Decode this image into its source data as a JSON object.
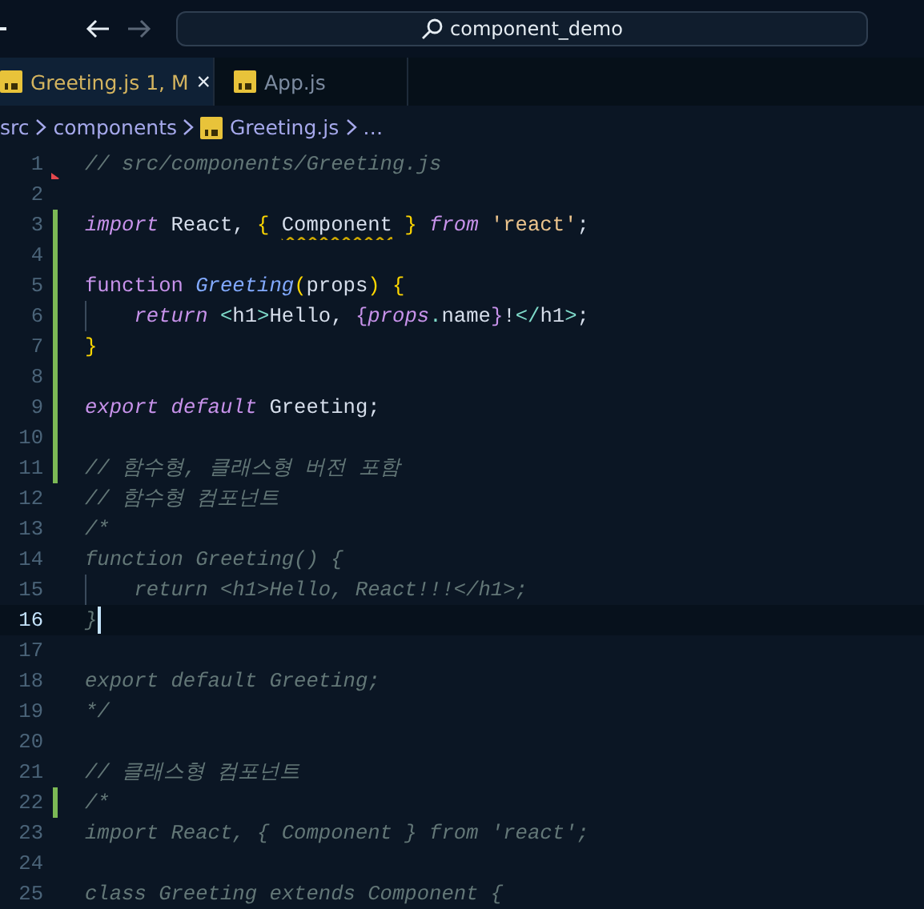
{
  "title_bar": {
    "back_disabled": false,
    "forward_disabled": true,
    "search": "component_demo"
  },
  "tabs": [
    {
      "label": "Greeting.js",
      "badge": "1, M",
      "selected": true,
      "close": "×"
    },
    {
      "label": "App.js",
      "selected": false
    }
  ],
  "breadcrumbs": [
    {
      "label": "src",
      "kind": "folder"
    },
    {
      "label": "components",
      "kind": "folder"
    },
    {
      "label": "Greeting.js",
      "kind": "file"
    },
    {
      "label": "…",
      "kind": "more"
    }
  ],
  "lines": [
    {
      "number": "1",
      "modified": false,
      "active": false,
      "problem": true,
      "indented": false,
      "tokens": [
        {
          "text": "// src/components/Greeting.js",
          "kind": "comment"
        }
      ]
    },
    {
      "number": "2",
      "modified": false,
      "active": false,
      "problem": false,
      "indented": false
    },
    {
      "number": "3",
      "modified": true,
      "active": false,
      "problem": false,
      "indented": false,
      "tokens": [
        {
          "text": "import",
          "kind": "keyword"
        },
        {
          "text": " React, ",
          "kind": "plain"
        },
        {
          "text": "{ ",
          "kind": "brace"
        },
        {
          "text": "Component",
          "kind": "plain",
          "warning": true
        },
        {
          "text": " }",
          "kind": "brace"
        },
        {
          "text": " from",
          "kind": "keyword"
        },
        {
          "text": " 'react'",
          "kind": "string"
        },
        {
          "text": ";",
          "kind": "plain"
        }
      ]
    },
    {
      "number": "4",
      "modified": true,
      "active": false,
      "problem": false,
      "indented": false
    },
    {
      "number": "5",
      "modified": true,
      "active": false,
      "problem": false,
      "indented": false,
      "tokens": [
        {
          "text": "function ",
          "kind": "storage"
        },
        {
          "text": "Greeting",
          "kind": "entity"
        },
        {
          "text": "(",
          "kind": "brace"
        },
        {
          "text": "props",
          "kind": "plain"
        },
        {
          "text": ") {",
          "kind": "brace"
        }
      ]
    },
    {
      "number": "6",
      "modified": true,
      "active": false,
      "problem": false,
      "indented": true,
      "tokens": [
        {
          "text": "return ",
          "kind": "keyword"
        },
        {
          "text": "<",
          "kind": "tag"
        },
        {
          "text": "h1",
          "kind": "plain"
        },
        {
          "text": ">",
          "kind": "tag"
        },
        {
          "text": "Hello, ",
          "kind": "plain"
        },
        {
          "text": "{",
          "kind": "jsxbrace"
        },
        {
          "text": "props",
          "kind": "variable"
        },
        {
          "text": ".",
          "kind": "tag"
        },
        {
          "text": "name",
          "kind": "plain"
        },
        {
          "text": "}",
          "kind": "jsxbrace"
        },
        {
          "text": "!",
          "kind": "plain"
        },
        {
          "text": "</",
          "kind": "tag"
        },
        {
          "text": "h1",
          "kind": "plain"
        },
        {
          "text": ">",
          "kind": "tag"
        },
        {
          "text": ";",
          "kind": "plain"
        }
      ]
    },
    {
      "number": "7",
      "modified": true,
      "active": false,
      "problem": false,
      "indented": false,
      "tokens": [
        {
          "text": "}",
          "kind": "brace"
        }
      ]
    },
    {
      "number": "8",
      "modified": true,
      "active": false,
      "problem": false,
      "indented": false
    },
    {
      "number": "9",
      "modified": true,
      "active": false,
      "problem": false,
      "indented": false,
      "tokens": [
        {
          "text": "export ",
          "kind": "keyword"
        },
        {
          "text": "default ",
          "kind": "keyword"
        },
        {
          "text": "Greeting;",
          "kind": "plain"
        }
      ]
    },
    {
      "number": "10",
      "modified": true,
      "active": false,
      "problem": false,
      "indented": false
    },
    {
      "number": "11",
      "modified": true,
      "active": false,
      "problem": false,
      "indented": false,
      "tokens": [
        {
          "text": "// 함수형, 클래스형 버전 포함",
          "kind": "comment"
        }
      ]
    },
    {
      "number": "12",
      "modified": false,
      "active": false,
      "problem": false,
      "indented": false,
      "tokens": [
        {
          "text": "// 함수형 컴포넌트",
          "kind": "comment"
        }
      ]
    },
    {
      "number": "13",
      "modified": false,
      "active": false,
      "problem": false,
      "indented": false,
      "tokens": [
        {
          "text": "/*",
          "kind": "comment"
        }
      ]
    },
    {
      "number": "14",
      "modified": false,
      "active": false,
      "problem": false,
      "indented": false,
      "tokens": [
        {
          "text": "function Greeting() {",
          "kind": "comment"
        }
      ]
    },
    {
      "number": "15",
      "modified": false,
      "active": false,
      "problem": false,
      "indented": true,
      "tokens": [
        {
          "text": "return <h1>Hello, React!!!</h1>;",
          "kind": "comment"
        }
      ]
    },
    {
      "number": "16",
      "modified": false,
      "active": true,
      "problem": false,
      "indented": false,
      "tokens": [
        {
          "text": "}",
          "kind": "comment"
        }
      ]
    },
    {
      "number": "17",
      "modified": false,
      "active": false,
      "problem": false,
      "indented": false
    },
    {
      "number": "18",
      "modified": false,
      "active": false,
      "problem": false,
      "indented": false,
      "tokens": [
        {
          "text": "export default Greeting;",
          "kind": "comment"
        }
      ]
    },
    {
      "number": "19",
      "modified": false,
      "active": false,
      "problem": false,
      "indented": false,
      "tokens": [
        {
          "text": "*/",
          "kind": "comment"
        }
      ]
    },
    {
      "number": "20",
      "modified": false,
      "active": false,
      "problem": false,
      "indented": false
    },
    {
      "number": "21",
      "modified": false,
      "active": false,
      "problem": false,
      "indented": false,
      "tokens": [
        {
          "text": "// 클래스형 컴포넌트",
          "kind": "comment"
        }
      ]
    },
    {
      "number": "22",
      "modified": true,
      "active": false,
      "problem": false,
      "indented": false,
      "tokens": [
        {
          "text": "/*",
          "kind": "comment"
        }
      ]
    },
    {
      "number": "23",
      "modified": false,
      "active": false,
      "problem": false,
      "indented": false,
      "tokens": [
        {
          "text": "import React, { Component } from 'react';",
          "kind": "comment"
        }
      ]
    },
    {
      "number": "24",
      "modified": false,
      "active": false,
      "problem": false,
      "indented": false
    },
    {
      "number": "25",
      "modified": false,
      "active": false,
      "problem": false,
      "indented": false,
      "tokens": [
        {
          "text": "class Greeting extends Component {",
          "kind": "comment"
        }
      ]
    }
  ]
}
